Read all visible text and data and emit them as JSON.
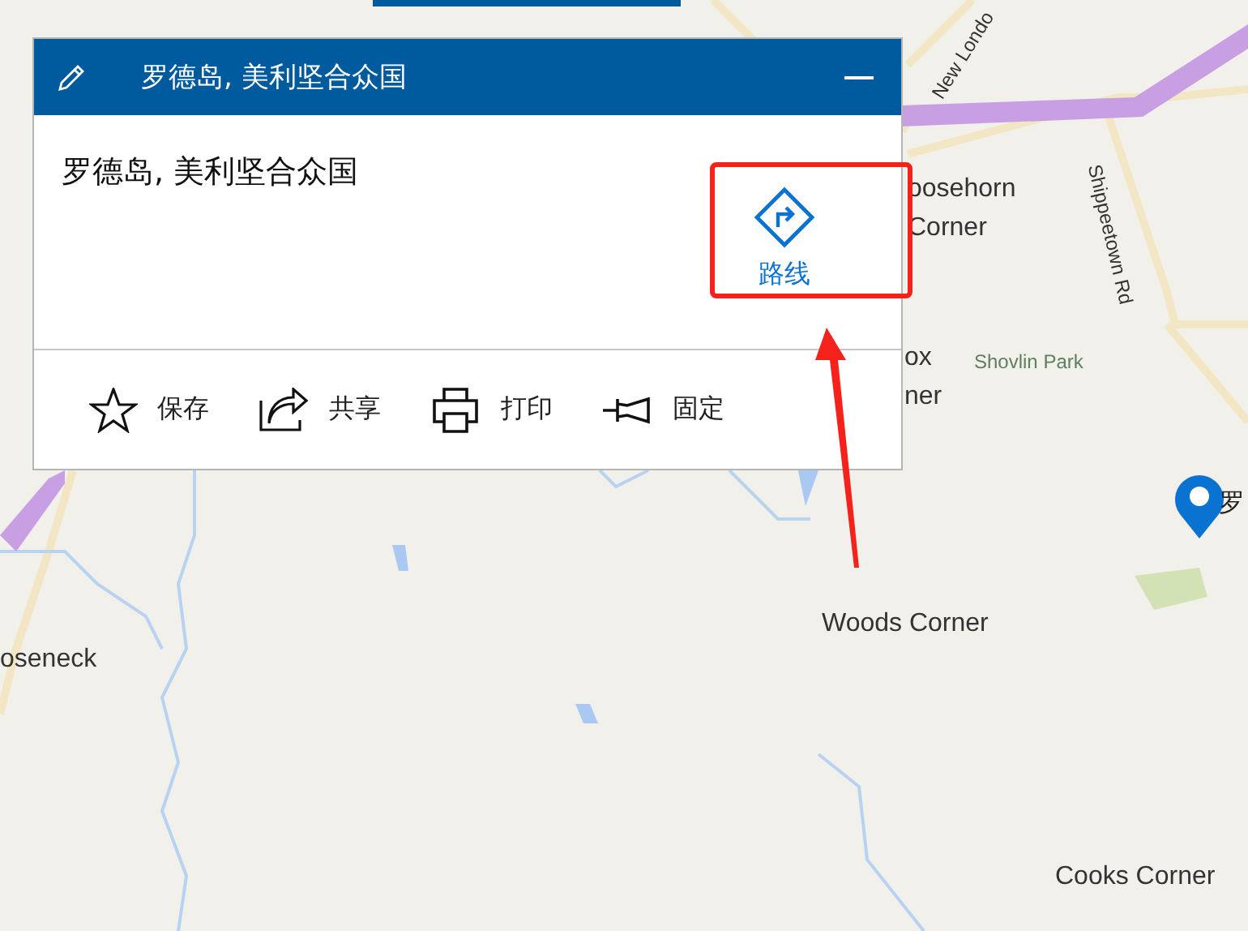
{
  "map": {
    "labels": [
      {
        "text": "New Londo"
      },
      {
        "text": "oosehorn"
      },
      {
        "text": "Corner"
      },
      {
        "text": "Shippeetown Rd"
      },
      {
        "text": "ox"
      },
      {
        "text": "ner"
      },
      {
        "text": "Shovlin Park"
      },
      {
        "text": "oseneck"
      },
      {
        "text": "Woods Corner"
      },
      {
        "text": "Cooks Corner"
      }
    ],
    "pin_label": "罗"
  },
  "card": {
    "title": "罗德岛, 美利坚合众国",
    "place_name": "罗德岛, 美利坚合众国",
    "route_button": "路线",
    "actions": [
      {
        "kind": "star",
        "label": "保存"
      },
      {
        "kind": "share",
        "label": "共享"
      },
      {
        "kind": "print",
        "label": "打印"
      },
      {
        "kind": "pin",
        "label": "固定"
      }
    ]
  }
}
